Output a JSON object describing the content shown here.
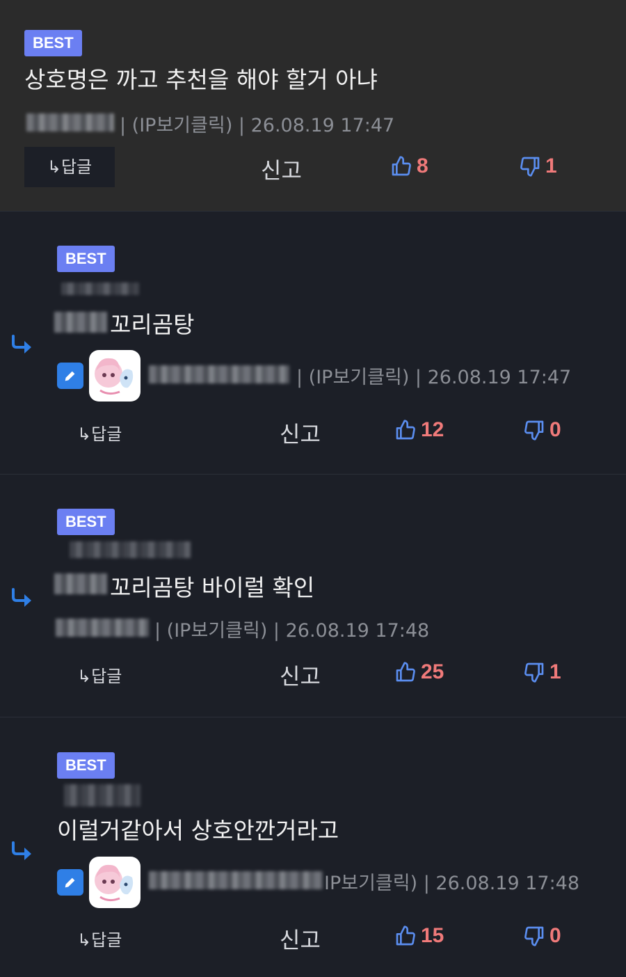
{
  "comments": [
    {
      "badge": "BEST",
      "text": "상호명은 까고 추천을 해야 할거 아냐",
      "meta": "| (IP보기클릭) | 26.08.19 17:47",
      "reply_label": "↳답글",
      "report_label": "신고",
      "likes": "8",
      "dislikes": "1"
    },
    {
      "badge": "BEST",
      "text": "꼬리곰탕",
      "meta": "| (IP보기클릭) | 26.08.19 17:47",
      "reply_label": "↳답글",
      "report_label": "신고",
      "likes": "12",
      "dislikes": "0"
    },
    {
      "badge": "BEST",
      "text": "꼬리곰탕 바이럴 확인",
      "meta": "| (IP보기클릭) | 26.08.19 17:48",
      "reply_label": "↳답글",
      "report_label": "신고",
      "likes": "25",
      "dislikes": "1"
    },
    {
      "badge": "BEST",
      "text": "이럴거같아서 상호안깐거라고",
      "meta": "IP보기클릭) | 26.08.19 17:48",
      "reply_label": "↳답글",
      "report_label": "신고",
      "likes": "15",
      "dislikes": "0"
    }
  ],
  "icons": {
    "reply_arrow": "reply-arrow-icon",
    "thumbs_up": "thumbs-up-icon",
    "thumbs_down": "thumbs-down-icon",
    "edit": "pencil-icon",
    "avatar": "avatar"
  },
  "colors": {
    "badge": "#6b7ff2",
    "vote_count": "#f07a7a",
    "thumb_icon": "#5b8ef0",
    "reply_arrow": "#2f7fe6"
  }
}
